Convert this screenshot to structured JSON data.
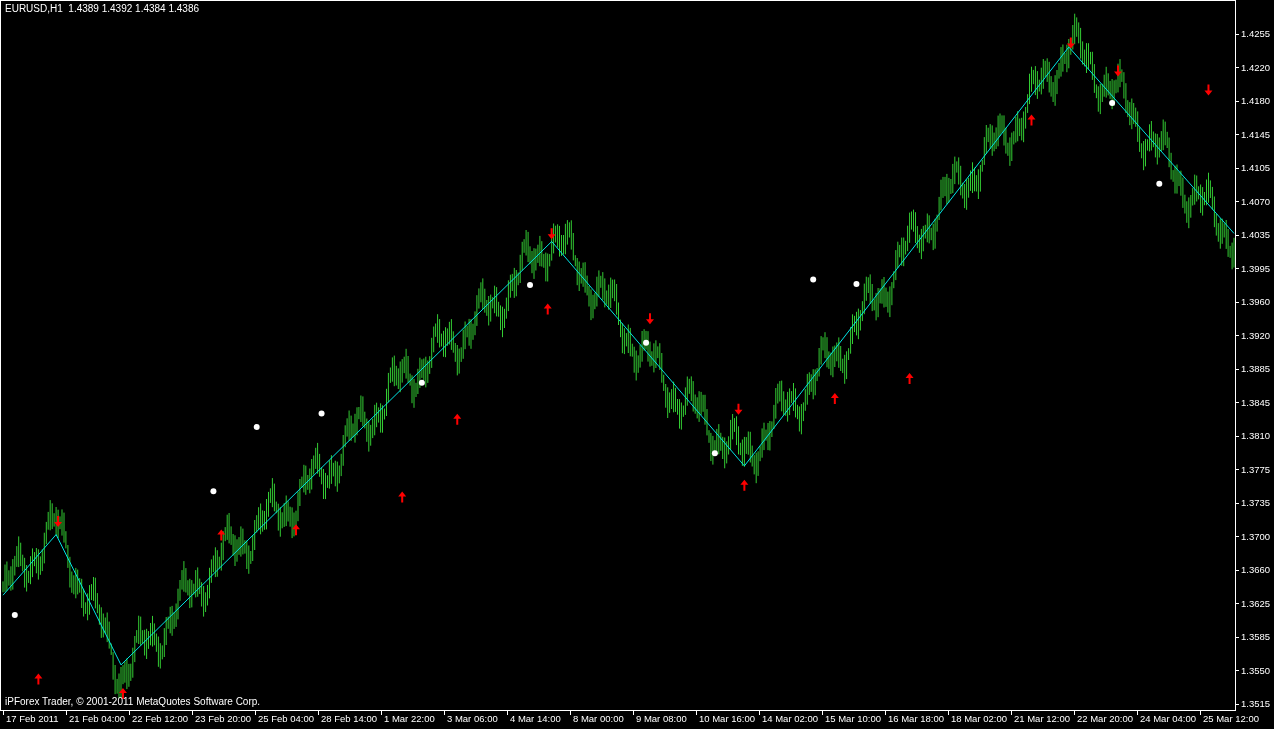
{
  "chart": {
    "header": "EURUSD,H1  1.4389 1.4392 1.4384 1.4386",
    "footer": "iPForex Trader, © 2001-2011 MetaQuotes Software Corp.",
    "price_axis": [
      "1.4255",
      "1.4220",
      "1.4180",
      "1.4145",
      "1.4105",
      "1.4070",
      "1.4035",
      "1.3995",
      "1.3960",
      "1.3920",
      "1.3885",
      "1.3845",
      "1.3810",
      "1.3775",
      "1.3735",
      "1.3700",
      "1.3660",
      "1.3625",
      "1.3585",
      "1.3550",
      "1.3515"
    ],
    "time_axis": [
      "17 Feb 2011",
      "21 Feb 04:00",
      "22 Feb 12:00",
      "23 Feb 20:00",
      "25 Feb 04:00",
      "28 Feb 14:00",
      "1 Mar 22:00",
      "3 Mar 06:00",
      "4 Mar 14:00",
      "8 Mar 00:00",
      "9 Mar 08:00",
      "10 Mar 16:00",
      "14 Mar 02:00",
      "15 Mar 10:00",
      "16 Mar 18:00",
      "18 Mar 02:00",
      "21 Mar 12:00",
      "22 Mar 20:00",
      "24 Mar 04:00",
      "25 Mar 12:00"
    ]
  }
}
